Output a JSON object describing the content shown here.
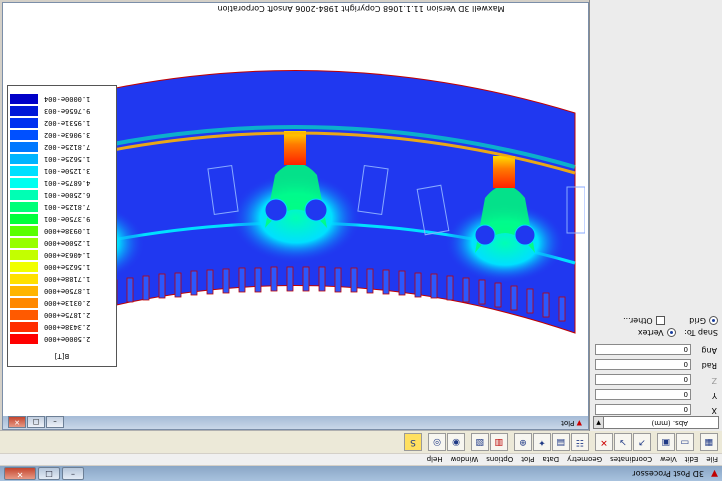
{
  "window": {
    "title": "3D Post Processor",
    "min_glyph": "–",
    "max_glyph": "□",
    "close_glyph": "✕"
  },
  "menu": [
    "File",
    "Edit",
    "View",
    "Coordinates",
    "Geometry",
    "Data",
    "Plot",
    "Options",
    "Window",
    "Help"
  ],
  "toolbar": {
    "icons": [
      "grid-icon",
      "open-icon",
      "save-icon",
      "plot-field-icon",
      "plot-vector-icon",
      "delete-plot-icon",
      "plot-options-icon",
      "surface-icon",
      "animate-icon",
      "zoom-icon",
      "select-icon",
      "deselect-icon",
      "eye-icon",
      "view-icon",
      "help-icon"
    ]
  },
  "left_panel": {
    "units_label": "Abs. (mm)",
    "coords": [
      {
        "label": "X",
        "value": "0"
      },
      {
        "label": "Y",
        "value": "0"
      },
      {
        "label": "Z",
        "value": "0"
      },
      {
        "label": "Rad",
        "value": "0"
      },
      {
        "label": "Ang",
        "value": "0"
      }
    ],
    "snap_label": "Snap To:",
    "snap_vertex": "Vertex",
    "grid": "Grid",
    "other": "Other..."
  },
  "mdi": {
    "title": "Plot",
    "copyright": "Maxwell 3D   Version 11.1.1068   Copyright 1984-2006 Ansoft Corporation"
  },
  "legend": {
    "title": "B[T]",
    "entries": [
      {
        "value": "2.5000e+000",
        "color": "#ff0000"
      },
      {
        "value": "2.3438e+000",
        "color": "#ff2d00"
      },
      {
        "value": "2.1875e+000",
        "color": "#ff5a00"
      },
      {
        "value": "2.0313e+000",
        "color": "#ff8800"
      },
      {
        "value": "1.8750e+000",
        "color": "#ffb400"
      },
      {
        "value": "1.7188e+000",
        "color": "#ffe000"
      },
      {
        "value": "1.5625e+000",
        "color": "#f0ff00"
      },
      {
        "value": "1.4063e+000",
        "color": "#c3ff00"
      },
      {
        "value": "1.2500e+000",
        "color": "#96ff00"
      },
      {
        "value": "1.0938e+000",
        "color": "#5aff00"
      },
      {
        "value": "9.3750e-001",
        "color": "#00ff3c"
      },
      {
        "value": "7.8125e-001",
        "color": "#00ff78"
      },
      {
        "value": "6.2500e-001",
        "color": "#00ffb4"
      },
      {
        "value": "4.6875e-001",
        "color": "#00fff0"
      },
      {
        "value": "3.1250e-001",
        "color": "#00e0ff"
      },
      {
        "value": "1.5625e-001",
        "color": "#00b4ff"
      },
      {
        "value": "7.8125e-002",
        "color": "#0078ff"
      },
      {
        "value": "3.9063e-002",
        "color": "#0050ff"
      },
      {
        "value": "1.9531e-002",
        "color": "#0030f0"
      },
      {
        "value": "9.7656e-003",
        "color": "#0018d8"
      },
      {
        "value": "1.0000e-004",
        "color": "#0000c8"
      }
    ]
  },
  "colors": {
    "field_background": "#2038f0",
    "slot_outline": "#c00000"
  }
}
